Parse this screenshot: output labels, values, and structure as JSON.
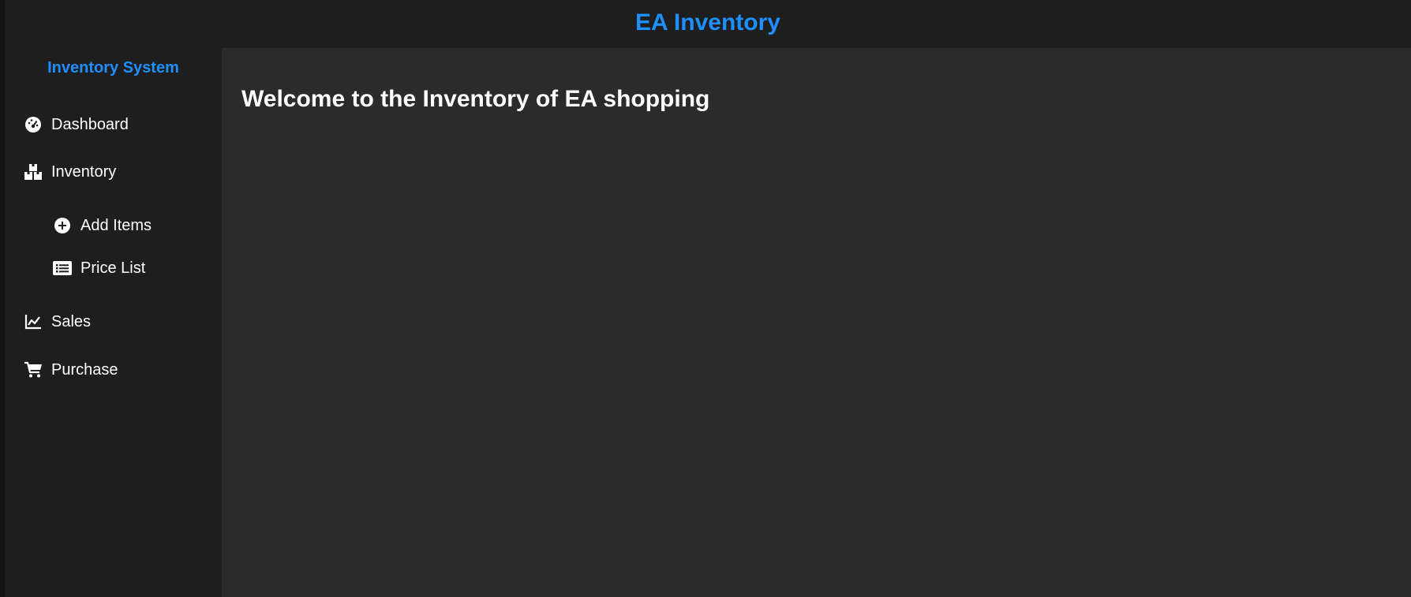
{
  "app": {
    "title": "EA Inventory"
  },
  "sidebar": {
    "brand": "Inventory System",
    "items": [
      {
        "label": "Dashboard",
        "icon": "dashboard-gauge-icon"
      },
      {
        "label": "Inventory",
        "icon": "boxes-icon"
      },
      {
        "label": "Add Items",
        "icon": "plus-circle-icon"
      },
      {
        "label": "Price List",
        "icon": "list-icon"
      },
      {
        "label": "Sales",
        "icon": "line-chart-icon"
      },
      {
        "label": "Purchase",
        "icon": "cart-icon"
      }
    ]
  },
  "main": {
    "heading": "Welcome to the Inventory of EA shopping"
  },
  "colors": {
    "accent": "#1e8fff",
    "sidebar_bg": "#1e1e1e",
    "main_bg": "#2b2b2b",
    "text": "#ffffff"
  }
}
